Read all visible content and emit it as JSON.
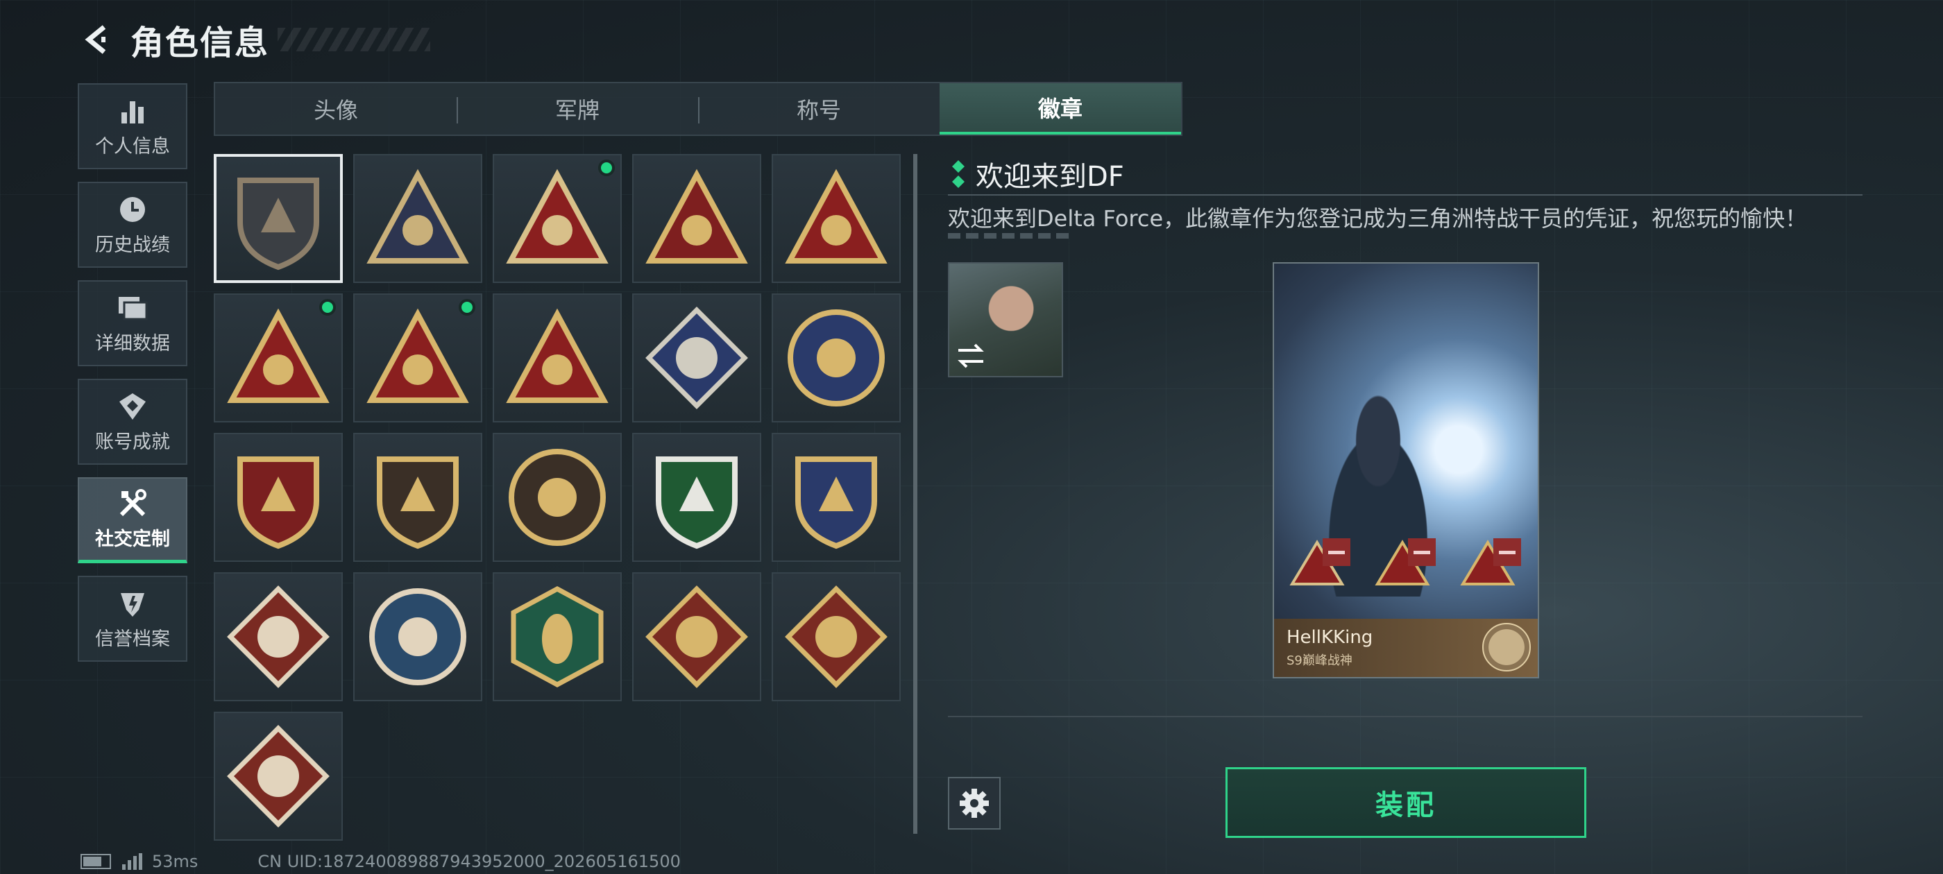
{
  "header": {
    "title": "角色信息"
  },
  "sidebar": {
    "items": [
      {
        "label": "个人信息",
        "icon": "bar-chart-icon",
        "active": false
      },
      {
        "label": "历史战绩",
        "icon": "clock-icon",
        "active": false
      },
      {
        "label": "详细数据",
        "icon": "folder-icon",
        "active": false
      },
      {
        "label": "账号成就",
        "icon": "achievement-icon",
        "active": false
      },
      {
        "label": "社交定制",
        "icon": "tools-icon",
        "active": true
      },
      {
        "label": "信誉档案",
        "icon": "shield-icon",
        "active": false
      }
    ]
  },
  "tabs": [
    {
      "label": "头像",
      "active": false
    },
    {
      "label": "军牌",
      "active": false
    },
    {
      "label": "称号",
      "active": false
    },
    {
      "label": "徽章",
      "active": true
    }
  ],
  "badges": [
    {
      "icon": "delta-shield-badge",
      "selected": true,
      "new": false,
      "colors": [
        "#3b3f44",
        "#8d7f6a"
      ]
    },
    {
      "icon": "helicopter-badge",
      "selected": false,
      "new": false,
      "colors": [
        "#2d3550",
        "#c9b07a"
      ]
    },
    {
      "icon": "s9-trophy-badge",
      "selected": false,
      "new": true,
      "colors": [
        "#8a1f1f",
        "#d8c08a"
      ]
    },
    {
      "icon": "nest-eggs-badge",
      "selected": false,
      "new": false,
      "colors": [
        "#7e1f1f",
        "#d7b66c"
      ]
    },
    {
      "icon": "number-one-badge",
      "selected": false,
      "new": false,
      "colors": [
        "#8a1f1f",
        "#d7b66c"
      ]
    },
    {
      "icon": "usb-drive-badge",
      "selected": false,
      "new": true,
      "colors": [
        "#8a1f1f",
        "#d7b66c"
      ]
    },
    {
      "icon": "kneeling-soldier-badge",
      "selected": false,
      "new": true,
      "colors": [
        "#8a1f1f",
        "#d7b66c"
      ]
    },
    {
      "icon": "squad-badge",
      "selected": false,
      "new": false,
      "colors": [
        "#8a1f1f",
        "#d7b66c"
      ]
    },
    {
      "icon": "rose-badge",
      "selected": false,
      "new": false,
      "colors": [
        "#2a3a6a",
        "#d0ccc0"
      ]
    },
    {
      "icon": "star-skull-badge",
      "selected": false,
      "new": false,
      "colors": [
        "#2a3a6a",
        "#d7b66c"
      ]
    },
    {
      "icon": "winged-star-badge",
      "selected": false,
      "new": false,
      "colors": [
        "#7a1f1f",
        "#d7b66c"
      ]
    },
    {
      "icon": "gem-shield-badge",
      "selected": false,
      "new": false,
      "colors": [
        "#3a2f26",
        "#d7b66c"
      ]
    },
    {
      "icon": "pearl-clam-badge",
      "selected": false,
      "new": false,
      "colors": [
        "#3a2f26",
        "#d7b66c"
      ]
    },
    {
      "icon": "rifle-crosshair-badge",
      "selected": false,
      "new": false,
      "colors": [
        "#1f5a33",
        "#e6e6e0"
      ]
    },
    {
      "icon": "crossed-blades-badge",
      "selected": false,
      "new": false,
      "colors": [
        "#2a3a6a",
        "#d7b66c"
      ]
    },
    {
      "icon": "wolf-head-badge",
      "selected": false,
      "new": false,
      "colors": [
        "#7a2a22",
        "#e2d4bd"
      ]
    },
    {
      "icon": "eagle-head-badge",
      "selected": false,
      "new": false,
      "colors": [
        "#2a4a6a",
        "#e2d4bd"
      ]
    },
    {
      "icon": "wasp-badge",
      "selected": false,
      "new": false,
      "colors": [
        "#1f5a45",
        "#d7b66c"
      ]
    },
    {
      "icon": "dragon-head-badge",
      "selected": false,
      "new": false,
      "colors": [
        "#7a2a22",
        "#d7b66c"
      ]
    },
    {
      "icon": "dragon-head-badge-2",
      "selected": false,
      "new": false,
      "colors": [
        "#7a2a22",
        "#d7b66c"
      ]
    },
    {
      "icon": "runner-badge",
      "selected": false,
      "new": false,
      "colors": [
        "#7a2a22",
        "#e2d4bd"
      ]
    }
  ],
  "detail": {
    "title": "欢迎来到DF",
    "description": "欢迎来到Delta Force，此徽章作为您登记成为三角洲特战干员的凭证，祝您玩的愉快！"
  },
  "card": {
    "player_name": "HellKKing",
    "player_subtitle": "S9巅峰战神",
    "slot_count": 3
  },
  "actions": {
    "equip_label": "装配"
  },
  "status": {
    "latency": "53ms",
    "uid": "CN UID:18724008988794395200​0_202605161500"
  },
  "colors": {
    "accent": "#2fd38a",
    "new_dot": "#22d885",
    "remove": "#8e2c2c"
  }
}
